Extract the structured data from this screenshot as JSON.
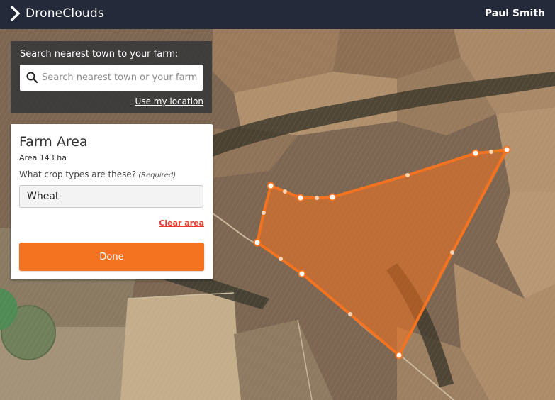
{
  "app": {
    "brand_name": "DroneClouds",
    "user_name": "Paul Smith"
  },
  "search": {
    "title": "Search nearest town to your farm:",
    "placeholder": "Search nearest town or your farm",
    "value": "",
    "use_location_label": "Use my location"
  },
  "farm_panel": {
    "title": "Farm Area",
    "area_text": "Area 143 ha",
    "crop_question": "What crop types are these?",
    "crop_required": "(Required)",
    "crop_value": "Wheat",
    "clear_label": "Clear area",
    "done_label": "Done"
  },
  "map": {
    "polygon_color": "#f47321",
    "vertex_color": "#ffffff"
  },
  "colors": {
    "topbar": "#242a3a",
    "accent": "#f47321",
    "clear_link": "#e53b2b"
  }
}
